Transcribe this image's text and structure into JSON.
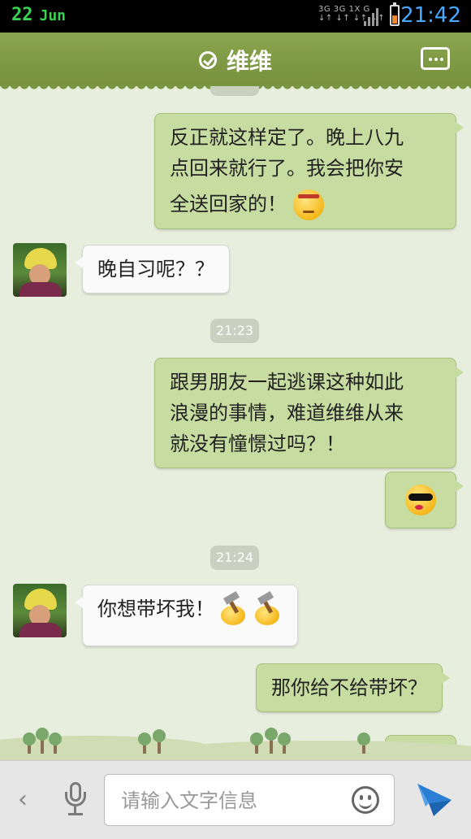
{
  "status_bar": {
    "day": "22",
    "month": "Jun",
    "network_line1": "3G 3G 1X G",
    "network_line2": "↓↑ ↓↑ ↓↑ ↓↑",
    "time": "21:42"
  },
  "header": {
    "title": "维维",
    "menu_icon": "chat-menu-icon"
  },
  "messages": [
    {
      "side": "out",
      "text_lines": [
        "反正就这样定了。晚上八九",
        "点回来就行了。我会把你安",
        "全送回家的！"
      ],
      "emoji": "angry-face"
    },
    {
      "side": "in",
      "text": "晚自习呢？？"
    },
    {
      "timestamp": "21:23"
    },
    {
      "side": "out",
      "text_lines": [
        "跟男朋友一起逃课这种如此",
        "浪漫的事情，难道维维从来",
        "就没有憧憬过吗？！"
      ]
    },
    {
      "side": "out",
      "emoji": "sunglasses-face"
    },
    {
      "timestamp": "21:24"
    },
    {
      "side": "in",
      "text": "你想带坏我！",
      "emoji": "hammer-faces"
    },
    {
      "side": "out",
      "text": "那你给不给带坏？"
    }
  ],
  "input_bar": {
    "placeholder": "请输入文字信息"
  },
  "colors": {
    "header_green": "#7f9a45",
    "outgoing_bubble": "#c6dca0",
    "incoming_bubble": "#fafafa",
    "chat_background": "#e8eede",
    "send_blue": "#2a7fd4"
  }
}
